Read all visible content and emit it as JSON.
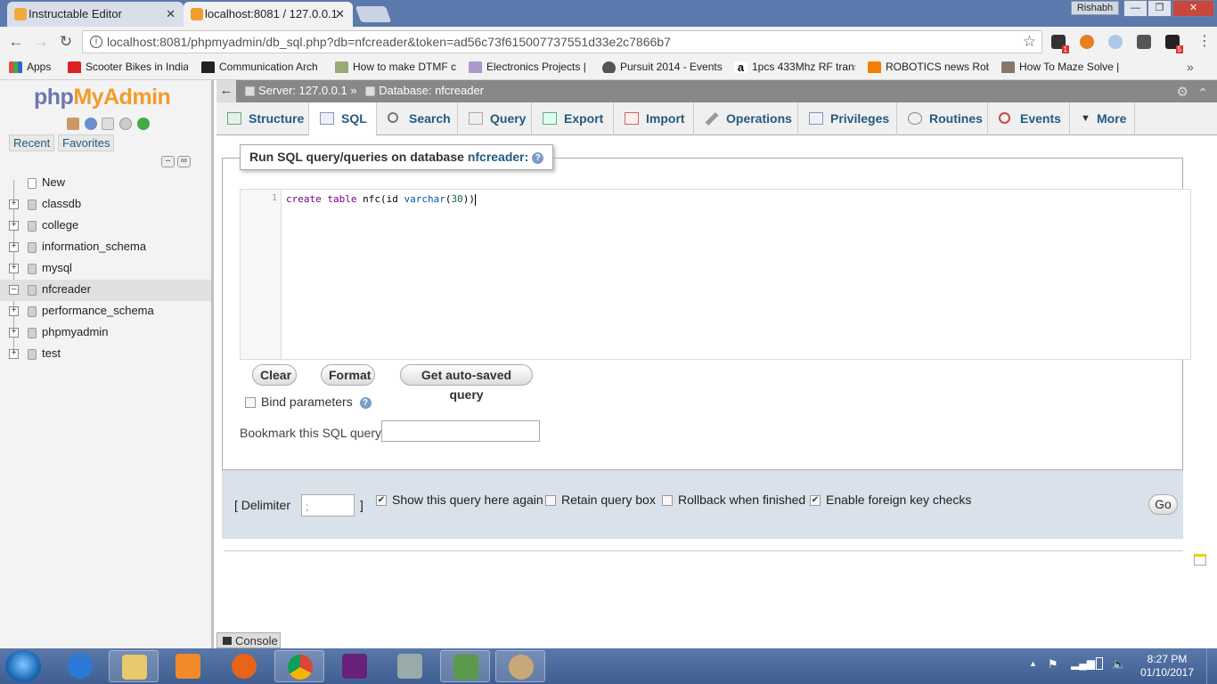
{
  "browser": {
    "tabs": [
      {
        "title": "Instructable Editor",
        "active": false
      },
      {
        "title": "localhost:8081 / 127.0.0.1",
        "active": true
      }
    ],
    "user_badge": "Rishabh",
    "url": "localhost:8081/phpmyadmin/db_sql.php?db=nfcreader&token=ad56c73f615007737551d33e2c7866b7",
    "extension_badges": {
      "first": "1",
      "second": "5"
    },
    "bookmarks": [
      "Apps",
      "Scooter Bikes in India",
      "Communication Arch",
      "How to make DTMF c",
      "Electronics Projects |",
      "Pursuit 2014 - Events",
      "1pcs 433Mhz RF trans",
      "ROBOTICS news Rob",
      "How To Maze Solve |"
    ]
  },
  "pma": {
    "logo": {
      "php": "php",
      "myadmin": "MyAdmin"
    },
    "nav_tabs": {
      "recent": "Recent",
      "favorites": "Favorites"
    },
    "databases": [
      {
        "name": "New",
        "selected": false
      },
      {
        "name": "classdb",
        "selected": false
      },
      {
        "name": "college",
        "selected": false
      },
      {
        "name": "information_schema",
        "selected": false
      },
      {
        "name": "mysql",
        "selected": false
      },
      {
        "name": "nfcreader",
        "selected": true
      },
      {
        "name": "performance_schema",
        "selected": false
      },
      {
        "name": "phpmyadmin",
        "selected": false
      },
      {
        "name": "test",
        "selected": false
      }
    ],
    "breadcrumb": {
      "server": "Server: 127.0.0.1 »",
      "database": "Database: nfcreader"
    },
    "tabs": [
      "Structure",
      "SQL",
      "Search",
      "Query",
      "Export",
      "Import",
      "Operations",
      "Privileges",
      "Routines",
      "Events",
      "More"
    ],
    "active_tab": "SQL",
    "legend": {
      "prefix": "Run SQL query/queries on database",
      "db": "nfcreader:"
    },
    "editor": {
      "line_number": "1",
      "code": {
        "kw1": "create",
        "kw2": "table",
        "name": "nfc(id",
        "type": "varchar",
        "paren": "(",
        "num": "30",
        "close": "))"
      }
    },
    "buttons": {
      "clear": "Clear",
      "format": "Format",
      "autosaved": "Get auto-saved query",
      "go": "Go"
    },
    "bind_parameters": "Bind parameters",
    "bookmark_label": "Bookmark this SQL query:",
    "bottom": {
      "delimiter_open": "[ Delimiter",
      "delimiter_value": ";",
      "delimiter_close": "]",
      "options": [
        {
          "label": "Show this query here again",
          "checked": true
        },
        {
          "label": "Retain query box",
          "checked": false
        },
        {
          "label": "Rollback when finished",
          "checked": false
        },
        {
          "label": "Enable foreign key checks",
          "checked": true
        }
      ]
    },
    "console": "Console"
  },
  "taskbar": {
    "time": "8:27 PM",
    "date": "01/10/2017"
  }
}
